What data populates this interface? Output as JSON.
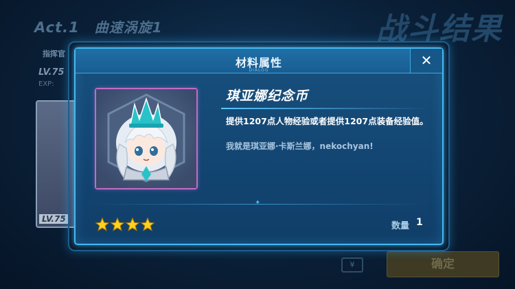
{
  "background": {
    "stage_act": "Act.1",
    "stage_name": "曲速涡旋1",
    "battle_result": "战斗结果",
    "commander_label": "指挥官",
    "level_label": "LV.75",
    "exp_label": "EXP:",
    "card_level": "LV.75",
    "confirm_label": "确定",
    "yen_label": "¥"
  },
  "dialog": {
    "title": "材料属性",
    "subtitle": "DIALOG",
    "close_label": "✕"
  },
  "item": {
    "name": "琪亚娜纪念币",
    "description": "提供1207点人物经验或者提供1207点装备经验值。",
    "flavor": "我就是琪亚娜·卡斯兰娜，nekochyan!",
    "rarity_stars": 4,
    "quantity_label": "数量",
    "quantity_value": "1"
  },
  "colors": {
    "dialog_border": "#44b9f2",
    "item_frame": "#c26bc7",
    "star": "#ffd21f"
  }
}
